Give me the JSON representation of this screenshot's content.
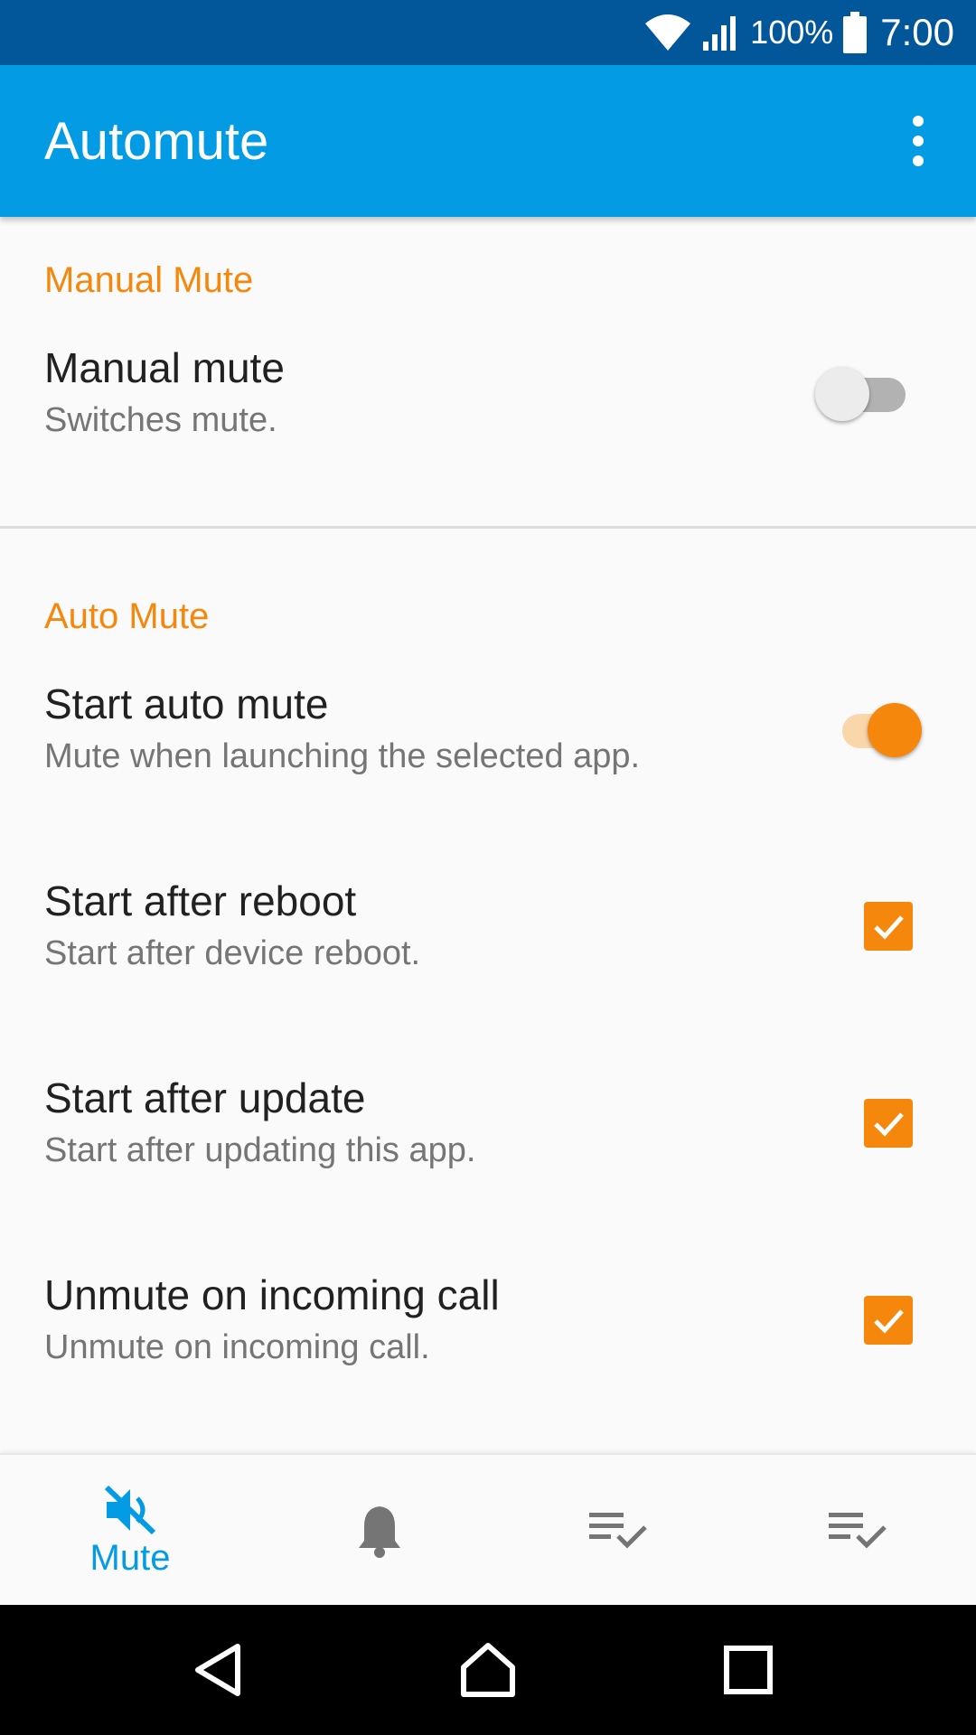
{
  "status_bar": {
    "battery_percent": "100%",
    "time": "7:00",
    "icons": [
      "wifi-icon",
      "cell-signal-icon",
      "battery-icon"
    ]
  },
  "app_bar": {
    "title": "Automute",
    "overflow_icon": "more-vert-icon"
  },
  "sections": {
    "manual": {
      "header": "Manual Mute",
      "item": {
        "title": "Manual mute",
        "summary": "Switches mute.",
        "switch_on": false
      }
    },
    "auto": {
      "header": "Auto Mute",
      "items": [
        {
          "title": "Start auto mute",
          "summary": "Mute when launching the selected app.",
          "control": "switch",
          "checked": true
        },
        {
          "title": "Start after reboot",
          "summary": "Start after device reboot.",
          "control": "checkbox",
          "checked": true
        },
        {
          "title": "Start after update",
          "summary": "Start after updating this app.",
          "control": "checkbox",
          "checked": true
        },
        {
          "title": "Unmute on incoming call",
          "summary": "Unmute on incoming call.",
          "control": "checkbox",
          "checked": true
        }
      ]
    }
  },
  "bottom_nav": {
    "items": [
      {
        "icon": "volume-off-icon",
        "label": "Mute",
        "active": true
      },
      {
        "icon": "bell-icon",
        "label": "",
        "active": false
      },
      {
        "icon": "playlist-check-icon",
        "label": "",
        "active": false
      },
      {
        "icon": "playlist-check-icon",
        "label": "",
        "active": false
      }
    ]
  },
  "colors": {
    "status_bar": "#02579b",
    "app_bar": "#049be5",
    "accent": "#f5880c",
    "nav_active": "#049be5",
    "nav_inactive": "#757575"
  },
  "system_nav": {
    "icons": [
      "back-icon",
      "home-icon",
      "recents-icon"
    ]
  }
}
